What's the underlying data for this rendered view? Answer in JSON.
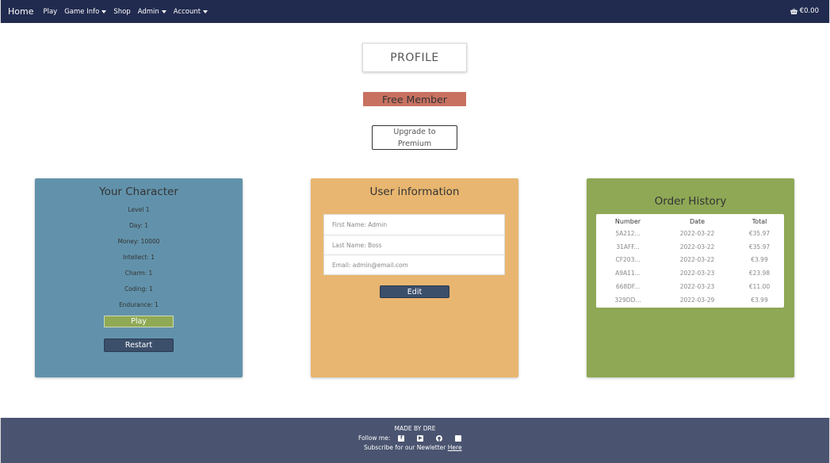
{
  "navbar": {
    "brand": "Home",
    "items": [
      {
        "label": "Play",
        "dropdown": false
      },
      {
        "label": "Game Info",
        "dropdown": true
      },
      {
        "label": "Shop",
        "dropdown": false
      },
      {
        "label": "Admin",
        "dropdown": true
      },
      {
        "label": "Account",
        "dropdown": true
      }
    ],
    "cart_total": "€0.00",
    "cart_icon": "shopping-basket-icon"
  },
  "profile": {
    "title": "PROFILE",
    "membership_badge": "Free Member",
    "upgrade_line1": "Upgrade to",
    "upgrade_line2": "Premium"
  },
  "character": {
    "title": "Your Character",
    "stats": [
      "Level 1",
      "Day: 1",
      "Money: 10000",
      "Intellect: 1",
      "Charm: 1",
      "Coding: 1",
      "Endurance: 1"
    ],
    "play_label": "Play",
    "restart_label": "Restart"
  },
  "user_info": {
    "title": "User information",
    "fields": [
      "First Name: Admin",
      "Last Name: Boss",
      "Email: admin@email.com"
    ],
    "edit_label": "Edit"
  },
  "order_history": {
    "title": "Order History",
    "headers": [
      "Number",
      "Date",
      "Total"
    ],
    "rows": [
      [
        "5A212...",
        "2022-03-22",
        "€35.97"
      ],
      [
        "31AFF...",
        "2022-03-22",
        "€35.97"
      ],
      [
        "CF203...",
        "2022-03-22",
        "€3.99"
      ],
      [
        "A9A11...",
        "2022-03-23",
        "€23.98"
      ],
      [
        "668DF...",
        "2022-03-23",
        "€11.00"
      ],
      [
        "329DD...",
        "2022-03-29",
        "€3.99"
      ]
    ]
  },
  "footer": {
    "made_by": "MADE BY DRE",
    "follow_label": "Follow me:",
    "social_icons": [
      "facebook-icon",
      "youtube-icon",
      "github-icon",
      "instagram-icon"
    ],
    "subscribe_text": "Subscribe for our Newletter",
    "subscribe_link": "Here"
  },
  "colors": {
    "navbar": "#212b4f",
    "footer": "#4a5470",
    "character_card": "#6292ab",
    "user_card": "#e8b670",
    "order_card": "#8ea855",
    "member_badge": "#c87161",
    "dark_button": "#3b4f6b"
  }
}
